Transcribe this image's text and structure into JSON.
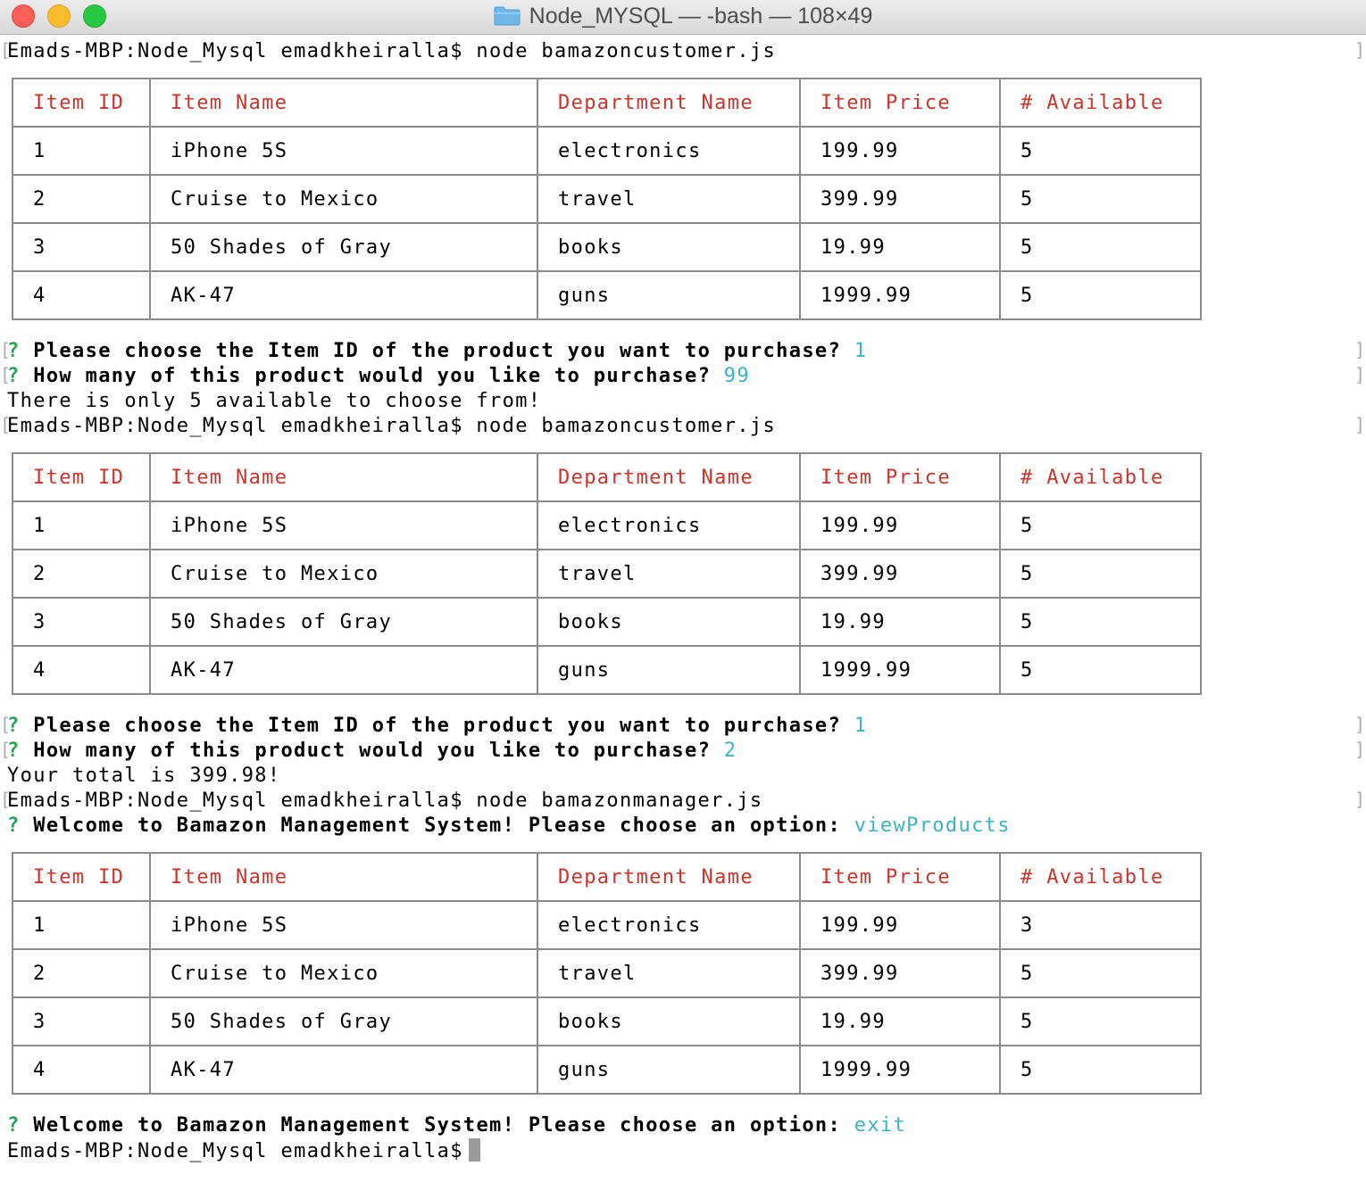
{
  "window": {
    "title": "Node_MYSQL — -bash — 108×49",
    "icon": "folder-icon",
    "colors": {
      "close": "#fc5f57",
      "minimize": "#fdbc2e",
      "maximize": "#28c840"
    }
  },
  "terminal": {
    "colors": {
      "header_text": "#c9342b",
      "prompt_mark": "#2aa35b",
      "answer": "#3bb3c3"
    },
    "prompt_mark": "?",
    "shell_1": "Emads-MBP:Node_Mysql emadkheiralla$ node bamazoncustomer.js",
    "shell_2": "Emads-MBP:Node_Mysql emadkheiralla$ node bamazoncustomer.js",
    "shell_3": "Emads-MBP:Node_Mysql emadkheiralla$ node bamazonmanager.js",
    "shell_4": "Emads-MBP:Node_Mysql emadkheiralla$",
    "q1": {
      "text": "Please choose the Item ID of the product you want to purchase?",
      "answer": "1"
    },
    "q2": {
      "text": "How many of this product would you like to purchase?",
      "answer": "99"
    },
    "msg1": "There is only 5 available to choose from!",
    "q3": {
      "text": "Please choose the Item ID of the product you want to purchase?",
      "answer": "1"
    },
    "q4": {
      "text": "How many of this product would you like to purchase?",
      "answer": "2"
    },
    "msg2": "Your total is 399.98!",
    "q5": {
      "text": "Welcome to Bamazon Management System! Please choose an option:",
      "answer": "viewProducts"
    },
    "q6": {
      "text": "Welcome to Bamazon Management System! Please choose an option:",
      "answer": "exit"
    }
  },
  "tables": {
    "headers": [
      "Item ID",
      "Item Name",
      "Department Name",
      "Item Price",
      "# Available"
    ],
    "t1": [
      [
        "1",
        "iPhone 5S",
        "electronics",
        "199.99",
        "5"
      ],
      [
        "2",
        "Cruise to Mexico",
        "travel",
        "399.99",
        "5"
      ],
      [
        "3",
        "50 Shades of Gray",
        "books",
        "19.99",
        "5"
      ],
      [
        "4",
        "AK-47",
        "guns",
        "1999.99",
        "5"
      ]
    ],
    "t2": [
      [
        "1",
        "iPhone 5S",
        "electronics",
        "199.99",
        "5"
      ],
      [
        "2",
        "Cruise to Mexico",
        "travel",
        "399.99",
        "5"
      ],
      [
        "3",
        "50 Shades of Gray",
        "books",
        "19.99",
        "5"
      ],
      [
        "4",
        "AK-47",
        "guns",
        "1999.99",
        "5"
      ]
    ],
    "t3": [
      [
        "1",
        "iPhone 5S",
        "electronics",
        "199.99",
        "3"
      ],
      [
        "2",
        "Cruise to Mexico",
        "travel",
        "399.99",
        "5"
      ],
      [
        "3",
        "50 Shades of Gray",
        "books",
        "19.99",
        "5"
      ],
      [
        "4",
        "AK-47",
        "guns",
        "1999.99",
        "5"
      ]
    ]
  }
}
